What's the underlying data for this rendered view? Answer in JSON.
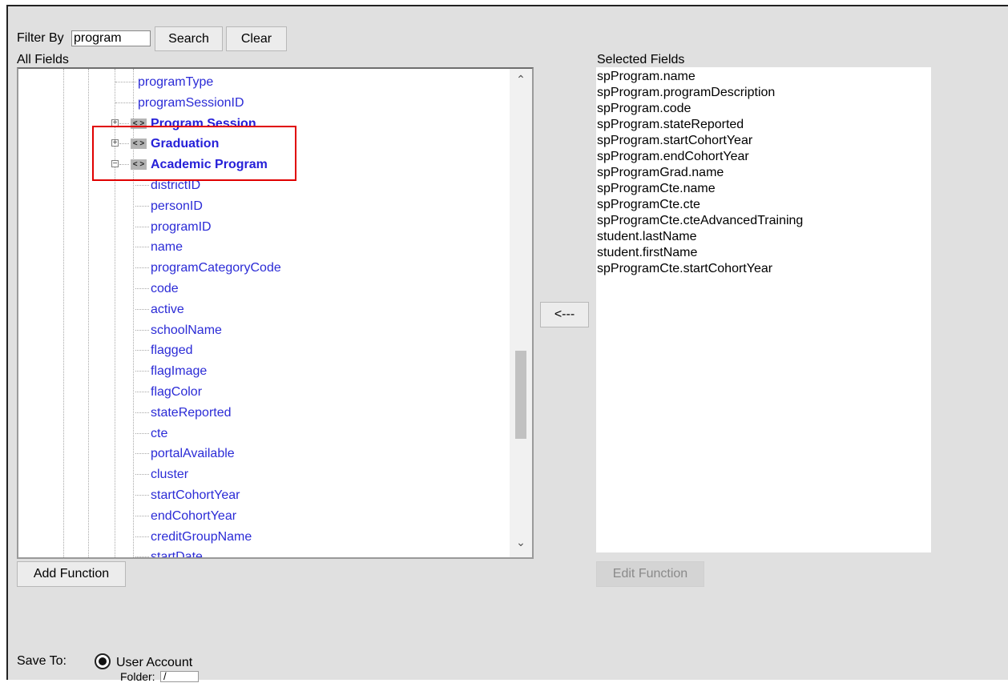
{
  "filter": {
    "label": "Filter By",
    "value": "program",
    "search_label": "Search",
    "clear_label": "Clear"
  },
  "all_fields": {
    "label": "All Fields",
    "tree": [
      {
        "type": "leaf",
        "label": "programType",
        "level": 1
      },
      {
        "type": "leaf",
        "label": "programSessionID",
        "level": 1
      },
      {
        "type": "node",
        "label": "Program Session",
        "state": "collapsed",
        "level": 1
      },
      {
        "type": "node",
        "label": "Graduation",
        "state": "collapsed",
        "level": 1
      },
      {
        "type": "node",
        "label": "Academic Program",
        "state": "expanded",
        "level": 1
      },
      {
        "type": "leaf",
        "label": "districtID",
        "level": 2
      },
      {
        "type": "leaf",
        "label": "personID",
        "level": 2
      },
      {
        "type": "leaf",
        "label": "programID",
        "level": 2
      },
      {
        "type": "leaf",
        "label": "name",
        "level": 2
      },
      {
        "type": "leaf",
        "label": "programCategoryCode",
        "level": 2
      },
      {
        "type": "leaf",
        "label": "code",
        "level": 2
      },
      {
        "type": "leaf",
        "label": "active",
        "level": 2
      },
      {
        "type": "leaf",
        "label": "schoolName",
        "level": 2
      },
      {
        "type": "leaf",
        "label": "flagged",
        "level": 2
      },
      {
        "type": "leaf",
        "label": "flagImage",
        "level": 2
      },
      {
        "type": "leaf",
        "label": "flagColor",
        "level": 2
      },
      {
        "type": "leaf",
        "label": "stateReported",
        "level": 2
      },
      {
        "type": "leaf",
        "label": "cte",
        "level": 2
      },
      {
        "type": "leaf",
        "label": "portalAvailable",
        "level": 2
      },
      {
        "type": "leaf",
        "label": "cluster",
        "level": 2
      },
      {
        "type": "leaf",
        "label": "startCohortYear",
        "level": 2
      },
      {
        "type": "leaf",
        "label": "endCohortYear",
        "level": 2
      },
      {
        "type": "leaf",
        "label": "creditGroupName",
        "level": 2
      },
      {
        "type": "leaf",
        "label": "startDate",
        "level": 2
      }
    ],
    "node_icon": "< >",
    "expanded_glyph": "−",
    "collapsed_glyph": "+"
  },
  "move_left_label": "<---",
  "selected_fields": {
    "label": "Selected Fields",
    "items": [
      "spProgram.name",
      "spProgram.programDescription",
      "spProgram.code",
      "spProgram.stateReported",
      "spProgram.startCohortYear",
      "spProgram.endCohortYear",
      "spProgramGrad.name",
      "spProgramCte.name",
      "spProgramCte.cte",
      "spProgramCte.cteAdvancedTraining",
      "student.lastName",
      "student.firstName",
      "spProgramCte.startCohortYear"
    ]
  },
  "add_function_label": "Add Function",
  "edit_function_label": "Edit Function",
  "save_to": {
    "label": "Save To:",
    "option_label": "User Account",
    "folder_label": "Folder:",
    "folder_value": "/"
  },
  "colors": {
    "field_link": "#2b2bd6",
    "highlight": "#e00000",
    "panel_bg": "#e0e0e0"
  }
}
